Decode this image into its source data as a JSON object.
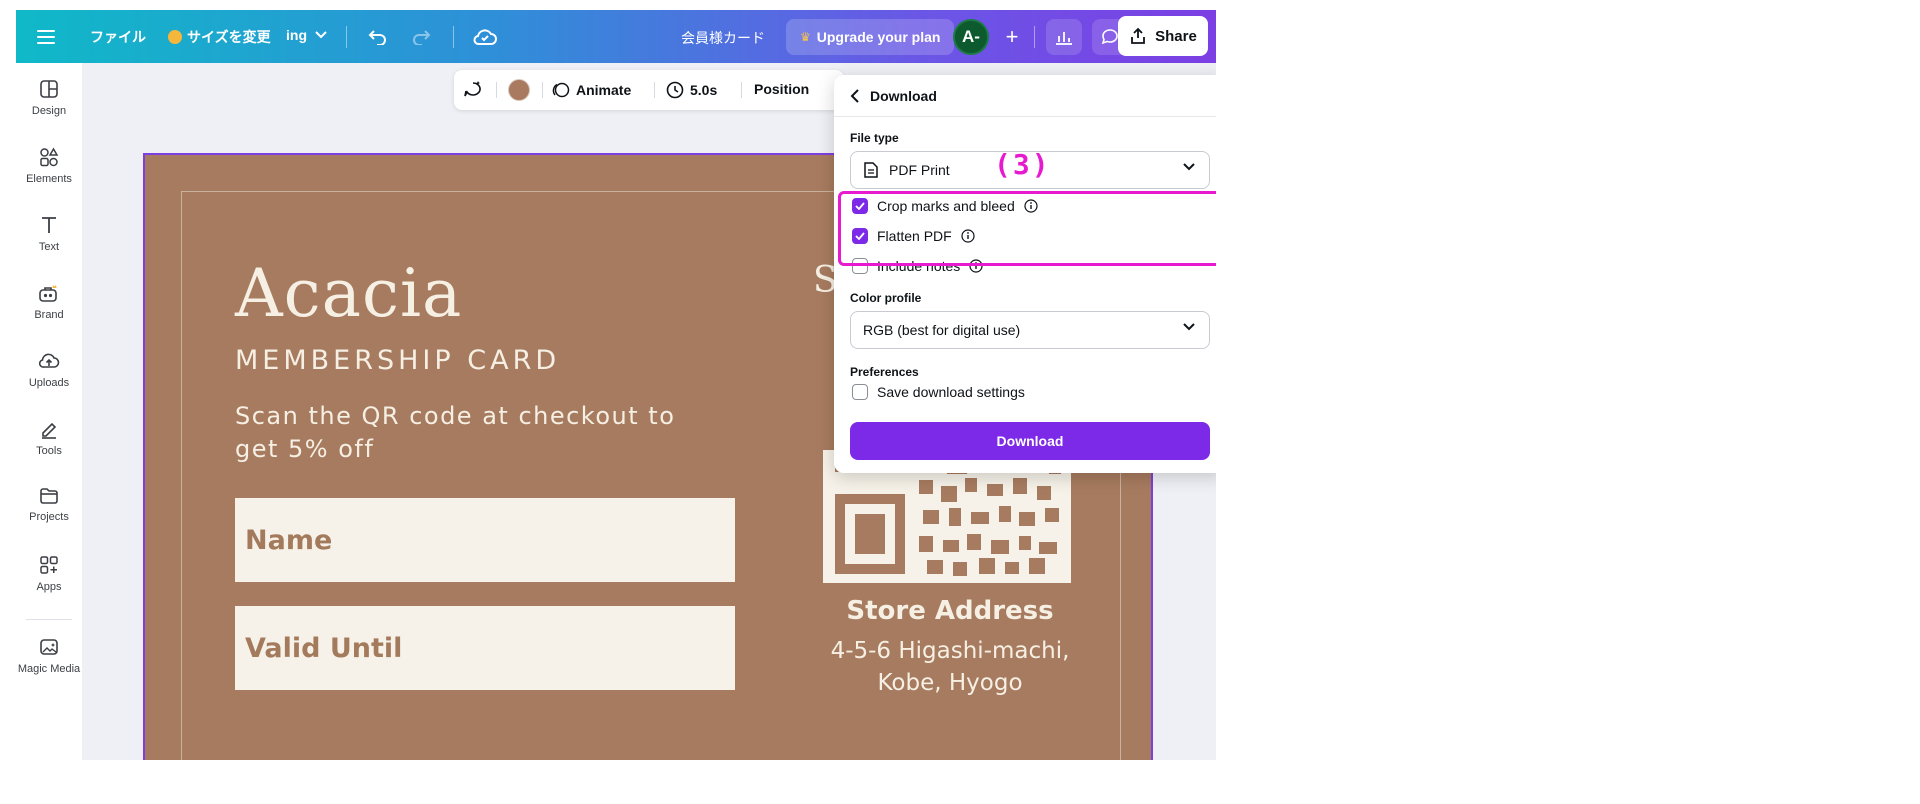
{
  "topbar": {
    "file_menu": "ファイル",
    "resize": "サイズを変更",
    "editing_mode": "ing",
    "doc_title": "会員様カード",
    "upgrade": "Upgrade your plan",
    "avatar_initials": "A-",
    "share": "Share"
  },
  "sidebar": {
    "items": [
      {
        "label": "Design",
        "icon": "layout-icon"
      },
      {
        "label": "Elements",
        "icon": "shapes-icon"
      },
      {
        "label": "Text",
        "icon": "text-icon"
      },
      {
        "label": "Brand",
        "icon": "briefcase-icon"
      },
      {
        "label": "Uploads",
        "icon": "cloud-upload-icon"
      },
      {
        "label": "Tools",
        "icon": "pen-icon"
      },
      {
        "label": "Projects",
        "icon": "folder-icon"
      },
      {
        "label": "Apps",
        "icon": "apps-icon"
      },
      {
        "label": "Magic Media",
        "icon": "magic-image-icon"
      }
    ]
  },
  "context_toolbar": {
    "animate": "Animate",
    "duration": "5.0s",
    "position": "Position",
    "color_swatch": "#a97a60"
  },
  "card": {
    "title": "Acacia",
    "subtitle": "MEMBERSHIP CARD",
    "scan_text": "Scan the QR code at checkout to get 5% off",
    "name_field": "Name",
    "valid_field": "Valid Until",
    "store_title": "Store Address",
    "store_address": "4-5-6 Higashi-machi, Kobe, Hyogo",
    "peek_letter": "S"
  },
  "download_panel": {
    "title": "Download",
    "file_type_label": "File type",
    "file_type_value": "PDF Print",
    "options": [
      {
        "label": "Crop marks and bleed",
        "checked": true
      },
      {
        "label": "Flatten PDF",
        "checked": true
      },
      {
        "label": "Include notes",
        "checked": false
      }
    ],
    "color_profile_label": "Color profile",
    "color_profile_value": "RGB (best for digital use)",
    "preferences_label": "Preferences",
    "save_settings": "Save download settings",
    "save_settings_checked": false,
    "download_button": "Download"
  },
  "annotation": {
    "label": "(3)",
    "color": "#e81ad0"
  },
  "colors": {
    "accent": "#7d2ae8",
    "canvas_bg": "#a77b5f"
  }
}
